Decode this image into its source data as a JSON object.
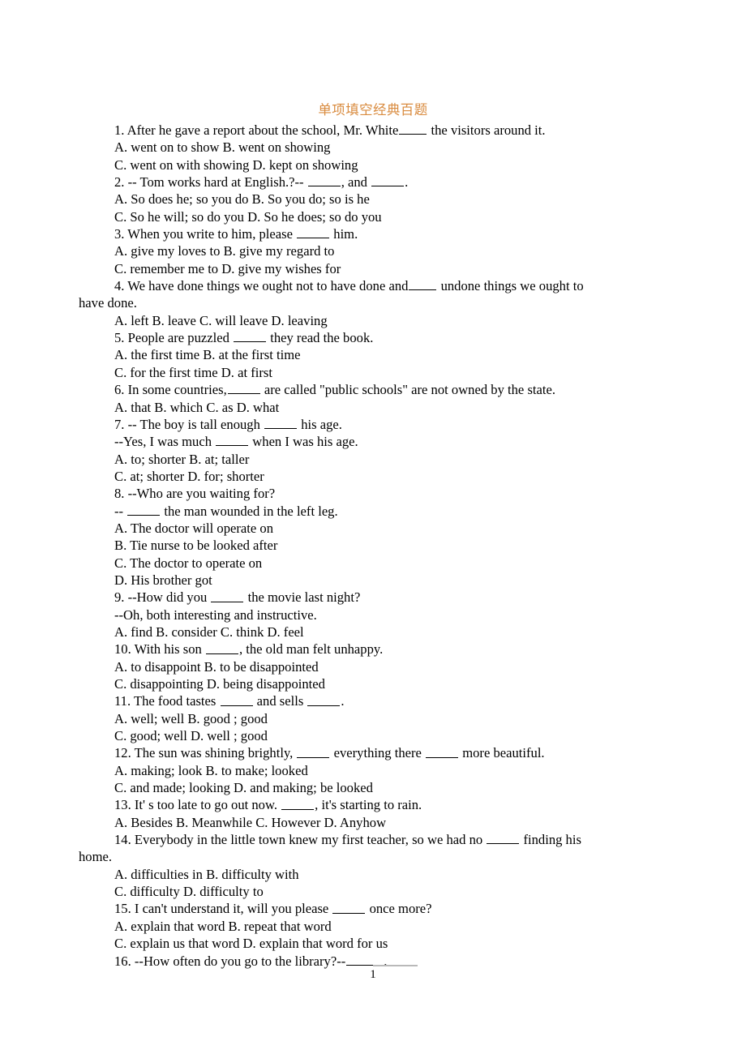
{
  "document": {
    "title": "单项填空经典百题",
    "title_color": "#d98b3f",
    "page_number": "1",
    "lines": [
      {
        "id": "q1-stem",
        "flush": false,
        "parts": [
          {
            "t": "text",
            "v": "1. After he gave a report about the school, Mr. White"
          },
          {
            "t": "blank",
            "w": 3
          },
          {
            "t": "text",
            "v": " the visitors around it."
          }
        ]
      },
      {
        "id": "q1-ab",
        "flush": false,
        "parts": [
          {
            "t": "text",
            "v": "A. went on to show B. went on showing"
          }
        ]
      },
      {
        "id": "q1-cd",
        "flush": false,
        "parts": [
          {
            "t": "text",
            "v": "C. went on with showing D. kept on showing"
          }
        ]
      },
      {
        "id": "q2-stem",
        "flush": false,
        "parts": [
          {
            "t": "text",
            "v": "2. -- Tom works hard at English.?-- "
          },
          {
            "t": "blank",
            "w": 4
          },
          {
            "t": "text",
            "v": ", and "
          },
          {
            "t": "blank",
            "w": 4
          },
          {
            "t": "text",
            "v": "."
          }
        ]
      },
      {
        "id": "q2-ab",
        "flush": false,
        "parts": [
          {
            "t": "text",
            "v": "A. So does he; so you do B. So you do; so is he"
          }
        ]
      },
      {
        "id": "q2-cd",
        "flush": false,
        "parts": [
          {
            "t": "text",
            "v": "C. So he will; so do you D. So he does; so do you"
          }
        ]
      },
      {
        "id": "q3-stem",
        "flush": false,
        "parts": [
          {
            "t": "text",
            "v": "3. When you write to him, please "
          },
          {
            "t": "blank",
            "w": 4
          },
          {
            "t": "text",
            "v": " him."
          }
        ]
      },
      {
        "id": "q3-ab",
        "flush": false,
        "parts": [
          {
            "t": "text",
            "v": "A. give my loves to B. give my regard to"
          }
        ]
      },
      {
        "id": "q3-cd",
        "flush": false,
        "parts": [
          {
            "t": "text",
            "v": "C. remember me to D. give my wishes for"
          }
        ]
      },
      {
        "id": "q4-stem",
        "flush": false,
        "parts": [
          {
            "t": "text",
            "v": "4. We have done things we ought not to have done and"
          },
          {
            "t": "blank",
            "w": 3
          },
          {
            "t": "text",
            "v": " undone things we ought to"
          }
        ]
      },
      {
        "id": "q4-stem2",
        "flush": true,
        "parts": [
          {
            "t": "text",
            "v": "have done."
          }
        ]
      },
      {
        "id": "q4-opts",
        "flush": false,
        "parts": [
          {
            "t": "text",
            "v": "A. left B. leave C. will leave D. leaving"
          }
        ]
      },
      {
        "id": "q5-stem",
        "flush": false,
        "parts": [
          {
            "t": "text",
            "v": "5. People are puzzled "
          },
          {
            "t": "blank",
            "w": 4
          },
          {
            "t": "text",
            "v": " they read the book."
          }
        ]
      },
      {
        "id": "q5-ab",
        "flush": false,
        "parts": [
          {
            "t": "text",
            "v": "A. the first time B. at the first time"
          }
        ]
      },
      {
        "id": "q5-cd",
        "flush": false,
        "parts": [
          {
            "t": "text",
            "v": "C. for the first time D. at first"
          }
        ]
      },
      {
        "id": "q6-stem",
        "flush": false,
        "parts": [
          {
            "t": "text",
            "v": "6. In some countries,"
          },
          {
            "t": "blank",
            "w": 4
          },
          {
            "t": "text",
            "v": " are called \"public schools\" are not owned by the state."
          }
        ]
      },
      {
        "id": "q6-opts",
        "flush": false,
        "parts": [
          {
            "t": "text",
            "v": "A. that B. which C. as D. what"
          }
        ]
      },
      {
        "id": "q7-stem",
        "flush": false,
        "parts": [
          {
            "t": "text",
            "v": "7. -- The boy is tall enough "
          },
          {
            "t": "blank",
            "w": 4
          },
          {
            "t": "text",
            "v": " his age."
          }
        ]
      },
      {
        "id": "q7-reply",
        "flush": false,
        "parts": [
          {
            "t": "text",
            "v": "--Yes, I was much "
          },
          {
            "t": "blank",
            "w": 4
          },
          {
            "t": "text",
            "v": " when I was his age."
          }
        ]
      },
      {
        "id": "q7-ab",
        "flush": false,
        "parts": [
          {
            "t": "text",
            "v": "A. to; shorter B. at; taller"
          }
        ]
      },
      {
        "id": "q7-cd",
        "flush": false,
        "parts": [
          {
            "t": "text",
            "v": "C. at; shorter D. for; shorter"
          }
        ]
      },
      {
        "id": "q8-stem",
        "flush": false,
        "parts": [
          {
            "t": "text",
            "v": "8. --Who are you waiting for?"
          }
        ]
      },
      {
        "id": "q8-reply",
        "flush": false,
        "parts": [
          {
            "t": "text",
            "v": "-- "
          },
          {
            "t": "blank",
            "w": 4
          },
          {
            "t": "text",
            "v": " the man wounded in the left leg."
          }
        ]
      },
      {
        "id": "q8-a",
        "flush": false,
        "parts": [
          {
            "t": "text",
            "v": "A. The doctor will operate on"
          }
        ]
      },
      {
        "id": "q8-b",
        "flush": false,
        "parts": [
          {
            "t": "text",
            "v": "B. Tie nurse to be looked after"
          }
        ]
      },
      {
        "id": "q8-c",
        "flush": false,
        "parts": [
          {
            "t": "text",
            "v": "C. The doctor to operate on"
          }
        ]
      },
      {
        "id": "q8-d",
        "flush": false,
        "parts": [
          {
            "t": "text",
            "v": "D. His brother got"
          }
        ]
      },
      {
        "id": "q9-stem",
        "flush": false,
        "parts": [
          {
            "t": "text",
            "v": "9. --How did you "
          },
          {
            "t": "blank",
            "w": 4
          },
          {
            "t": "text",
            "v": " the movie last night?"
          }
        ]
      },
      {
        "id": "q9-reply",
        "flush": false,
        "parts": [
          {
            "t": "text",
            "v": "--Oh, both interesting and instructive."
          }
        ]
      },
      {
        "id": "q9-opts",
        "flush": false,
        "parts": [
          {
            "t": "text",
            "v": "A. find B. consider C. think D. feel"
          }
        ]
      },
      {
        "id": "q10-stem",
        "flush": false,
        "parts": [
          {
            "t": "text",
            "v": "10. With his son "
          },
          {
            "t": "blank",
            "w": 4
          },
          {
            "t": "text",
            "v": ", the old man felt unhappy."
          }
        ]
      },
      {
        "id": "q10-ab",
        "flush": false,
        "parts": [
          {
            "t": "text",
            "v": "A. to disappoint B. to be disappointed"
          }
        ]
      },
      {
        "id": "q10-cd",
        "flush": false,
        "parts": [
          {
            "t": "text",
            "v": "C. disappointing D. being disappointed"
          }
        ]
      },
      {
        "id": "q11-stem",
        "flush": false,
        "parts": [
          {
            "t": "text",
            "v": "11. The food tastes "
          },
          {
            "t": "blank",
            "w": 4
          },
          {
            "t": "text",
            "v": " and sells "
          },
          {
            "t": "blank",
            "w": 4
          },
          {
            "t": "text",
            "v": "."
          }
        ]
      },
      {
        "id": "q11-ab",
        "flush": false,
        "parts": [
          {
            "t": "text",
            "v": "A. well; well B. good ; good"
          }
        ]
      },
      {
        "id": "q11-cd",
        "flush": false,
        "parts": [
          {
            "t": "text",
            "v": "C. good; well D. well ; good"
          }
        ]
      },
      {
        "id": "q12-stem",
        "flush": false,
        "parts": [
          {
            "t": "text",
            "v": "12. The sun was shining brightly, "
          },
          {
            "t": "blank",
            "w": 4
          },
          {
            "t": "text",
            "v": " everything there "
          },
          {
            "t": "blank",
            "w": 4
          },
          {
            "t": "text",
            "v": " more beautiful."
          }
        ]
      },
      {
        "id": "q12-ab",
        "flush": false,
        "parts": [
          {
            "t": "text",
            "v": "A. making; look B. to make; looked"
          }
        ]
      },
      {
        "id": "q12-cd",
        "flush": false,
        "parts": [
          {
            "t": "text",
            "v": "C. and made; looking D. and making; be looked"
          }
        ]
      },
      {
        "id": "q13-stem",
        "flush": false,
        "parts": [
          {
            "t": "text",
            "v": "13. It' s too late to go out now. "
          },
          {
            "t": "blank",
            "w": 4
          },
          {
            "t": "text",
            "v": ", it's starting to rain."
          }
        ]
      },
      {
        "id": "q13-opts",
        "flush": false,
        "parts": [
          {
            "t": "text",
            "v": "A. Besides B. Meanwhile C. However D. Anyhow"
          }
        ]
      },
      {
        "id": "q14-stem",
        "flush": false,
        "parts": [
          {
            "t": "text",
            "v": "14. Everybody in the little town knew my first teacher, so we had no "
          },
          {
            "t": "blank",
            "w": 4
          },
          {
            "t": "text",
            "v": " finding his"
          }
        ]
      },
      {
        "id": "q14-stem2",
        "flush": true,
        "parts": [
          {
            "t": "text",
            "v": "home."
          }
        ]
      },
      {
        "id": "q14-ab",
        "flush": false,
        "parts": [
          {
            "t": "text",
            "v": "A. difficulties in B. difficulty with"
          }
        ]
      },
      {
        "id": "q14-cd",
        "flush": false,
        "parts": [
          {
            "t": "text",
            "v": "C. difficulty D. difficulty to"
          }
        ]
      },
      {
        "id": "q15-stem",
        "flush": false,
        "parts": [
          {
            "t": "text",
            "v": "15. I can't understand it, will you please "
          },
          {
            "t": "blank",
            "w": 4
          },
          {
            "t": "text",
            "v": " once more?"
          }
        ]
      },
      {
        "id": "q15-ab",
        "flush": false,
        "parts": [
          {
            "t": "text",
            "v": "A. explain that word B. repeat that word"
          }
        ]
      },
      {
        "id": "q15-cd",
        "flush": false,
        "parts": [
          {
            "t": "text",
            "v": "C. explain us that word D. explain that word for us"
          }
        ]
      },
      {
        "id": "q16-stem",
        "flush": false,
        "parts": [
          {
            "t": "text",
            "v": "16. --How often do you go to the library?--"
          },
          {
            "t": "blank",
            "w": 5
          },
          {
            "t": "text",
            "v": "."
          }
        ]
      }
    ]
  }
}
